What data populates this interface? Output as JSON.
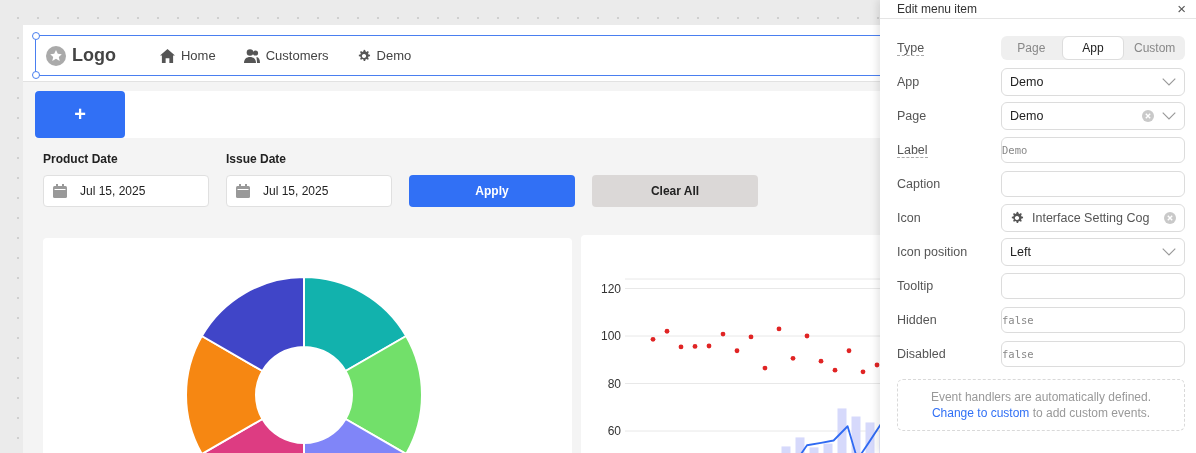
{
  "header": {
    "logo": "Logo",
    "nav": [
      {
        "label": "Home",
        "kind": "home"
      },
      {
        "label": "Customers",
        "kind": "users"
      },
      {
        "label": "Demo",
        "kind": "cog"
      }
    ]
  },
  "toolbar": {
    "add_button": "+"
  },
  "filters": [
    {
      "label": "Product Date",
      "value": "Jul 15, 2025"
    },
    {
      "label": "Issue Date",
      "value": "Jul 15, 2025"
    }
  ],
  "actions": [
    {
      "label": "Apply",
      "kind": "primary"
    },
    {
      "label": "Clear All",
      "kind": "secondary"
    }
  ],
  "scatter_card": {
    "y_axis_labels": [
      "120",
      "100",
      "80",
      "60"
    ]
  },
  "panel": {
    "title": "Edit menu item",
    "close": "×",
    "fields": [
      {
        "label": "Type",
        "kind": "segmented",
        "hint": true,
        "options": [
          {
            "label": "Page",
            "selected": false
          },
          {
            "label": "App",
            "selected": true
          },
          {
            "label": "Custom",
            "selected": false
          }
        ]
      },
      {
        "label": "App",
        "kind": "select",
        "hint": false,
        "value": "Demo",
        "clearable": false
      },
      {
        "label": "Page",
        "kind": "select",
        "hint": false,
        "value": "Demo",
        "clearable": true
      },
      {
        "label": "Label",
        "kind": "text",
        "hint": true,
        "placeholder": "Demo"
      },
      {
        "label": "Caption",
        "kind": "text",
        "hint": false
      },
      {
        "label": "Icon",
        "kind": "icon",
        "hint": false,
        "value": "Interface Setting Cog",
        "clearable": true
      },
      {
        "label": "Icon position",
        "kind": "select",
        "hint": false,
        "value": "Left",
        "clearable": false
      },
      {
        "label": "Tooltip",
        "kind": "text",
        "hint": false
      },
      {
        "label": "Hidden",
        "kind": "text",
        "hint": false,
        "placeholder": "false"
      },
      {
        "label": "Disabled",
        "kind": "text",
        "hint": false,
        "placeholder": "false"
      }
    ],
    "note": {
      "text": "Event handlers are automatically defined.",
      "link": "Change to custom",
      "after": "to add custom events."
    }
  }
}
